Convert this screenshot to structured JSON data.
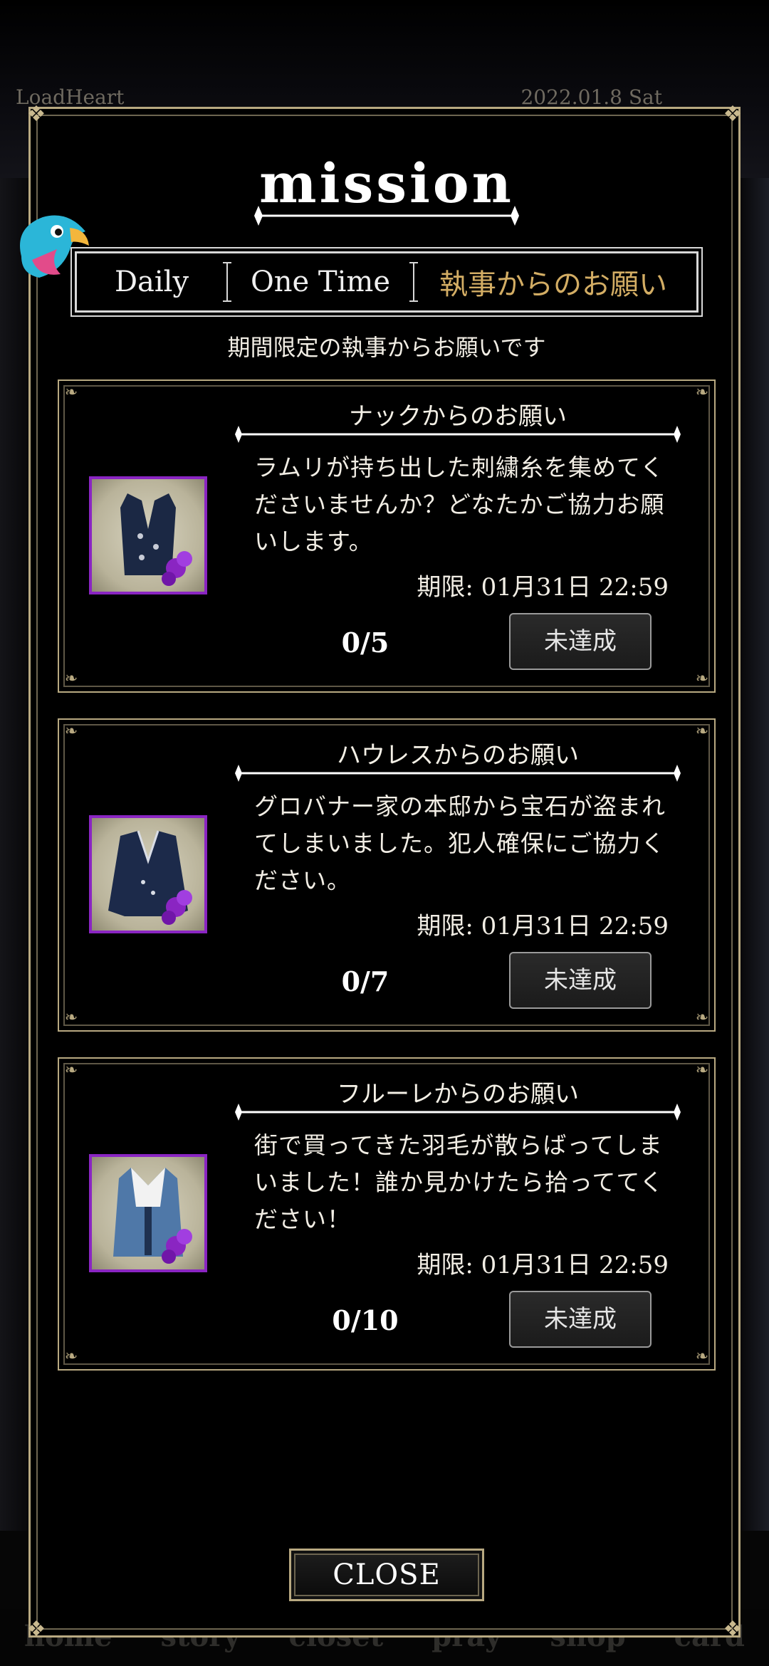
{
  "background": {
    "brand_text": "LoadHeart",
    "date_text": "2022.01.8 Sat",
    "nav_items": [
      "home",
      "story",
      "closet",
      "pray",
      "shop",
      "card"
    ]
  },
  "modal": {
    "title": "mission",
    "tabs": [
      {
        "label": "Daily",
        "active": false
      },
      {
        "label": "One Time",
        "active": false
      },
      {
        "label": "執事からのお願い",
        "active": true
      }
    ],
    "subtitle": "期間限定の執事からお願いです",
    "missions": [
      {
        "title": "ナックからのお願い",
        "description": "ラムリが持ち出した刺繍糸を集めてくださいませんか？どなたかご協力お願いします。",
        "deadline": "期限: 01月31日 22:59",
        "progress": "0/5",
        "status": "未達成",
        "item_icon": "vest-icon"
      },
      {
        "title": "ハウレスからのお願い",
        "description": "グロバナー家の本邸から宝石が盗まれてしまいました。犯人確保にご協力ください。",
        "deadline": "期限: 01月31日 22:59",
        "progress": "0/7",
        "status": "未達成",
        "item_icon": "jacket-icon"
      },
      {
        "title": "フルーレからのお願い",
        "description": "街で買ってきた羽毛が散らばってしまいました！誰か見かけたら拾っててください！",
        "deadline": "期限: 01月31日 22:59",
        "progress": "0/10",
        "status": "未達成",
        "item_icon": "coat-icon"
      }
    ],
    "close_label": "CLOSE"
  },
  "colors": {
    "gold_border": "#b8a981",
    "active_tab": "#d3ad64",
    "thumb_border": "#8a25c2"
  }
}
